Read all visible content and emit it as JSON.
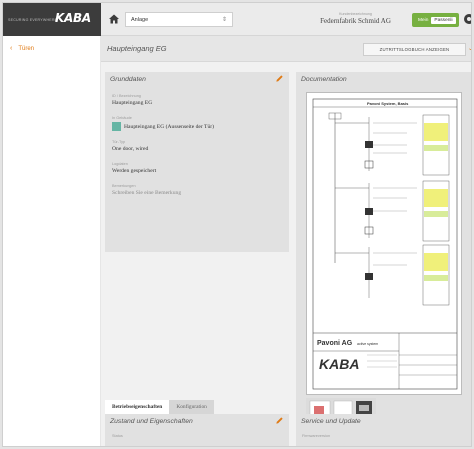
{
  "brand": {
    "tagline": "SECURING EVERYWHERE",
    "logo": "KABA"
  },
  "toolbar": {
    "plant_select_value": "Anlage",
    "customer_label": "Kundenbezeichnung",
    "customer_name": "Federnfabrik Schmid AG",
    "user_label": "Mein",
    "user_name": "Passenli"
  },
  "nav": {
    "back_label": "Türen"
  },
  "header": {
    "title": "Haupteingang EG",
    "log_button": "ZUTRITTSLOGBUCH ANZEIGEN"
  },
  "grunddaten": {
    "title": "Grunddaten",
    "fields": [
      {
        "label": "ID / Bezeichnung",
        "value": "Haupteingang EG"
      },
      {
        "label": "In Gebäude",
        "value": "Haupteingang EG (Aussenseite der Tür)"
      },
      {
        "label": "Tür-Typ",
        "value": "One door, wired"
      },
      {
        "label": "Logdaten",
        "value": "Werden gespeichert"
      },
      {
        "label": "Bemerkungen",
        "value": "Schreiben Sie eine Bemerkung"
      }
    ],
    "component_color": "#65b5a4"
  },
  "documentation": {
    "title": "Documentation",
    "sheet": {
      "heading": "Pavoni System, Basis",
      "company": "Pavoni AG",
      "company_suffix": "active system",
      "logo": "KABA"
    }
  },
  "tabs": [
    {
      "label": "Betriebseigenschaften",
      "active": true
    },
    {
      "label": "Konfiguration",
      "active": false
    }
  ],
  "zustand": {
    "title": "Zustand und Eigenschaften",
    "status_label": "Status"
  },
  "service": {
    "title": "Service und Update",
    "sub_label": "Firmwareversion"
  },
  "colors": {
    "accent": "#e07a14",
    "user_pill": "#77b041",
    "brand_bg": "#3c3c3c"
  }
}
